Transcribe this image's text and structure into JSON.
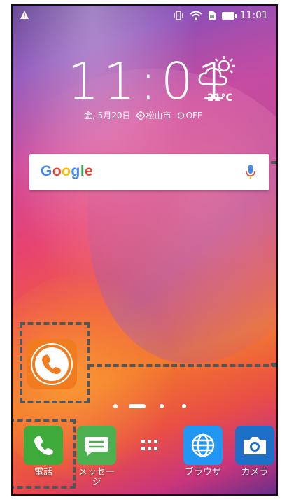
{
  "status_bar": {
    "left_icon": "warning-icon",
    "right_icons": [
      "vibrate-icon",
      "wifi-icon",
      "sim-icon",
      "battery-icon"
    ],
    "time": "11:01"
  },
  "clock": {
    "time": "11:01",
    "weather_icon": "partly-cloudy-icon",
    "temperature": "21°C",
    "date": "金, 5月20日",
    "location": "松山市",
    "alarm": "OFF"
  },
  "search": {
    "logo": "Google",
    "logo_colors": [
      "#4285F4",
      "#EA4335",
      "#FBBC05",
      "#4285F4",
      "#34A853",
      "#EA4335"
    ],
    "mic_icon": "mic-icon"
  },
  "home_app": {
    "icon": "phone-orange-icon",
    "color": "#F07C1F"
  },
  "page_indicator": {
    "count": 4,
    "active_index": 1
  },
  "dock": [
    {
      "label": "電話",
      "icon": "phone-icon",
      "color": "#3DAA3A"
    },
    {
      "label": "メッセージ",
      "icon": "message-icon",
      "color": "#4CAF50"
    },
    {
      "label": "",
      "icon": "app-drawer-icon",
      "color": "#FFFFFF"
    },
    {
      "label": "ブラウザ",
      "icon": "globe-icon",
      "color": "#2196F3"
    },
    {
      "label": "カメラ",
      "icon": "camera-icon",
      "color": "#1E6FC7"
    }
  ]
}
